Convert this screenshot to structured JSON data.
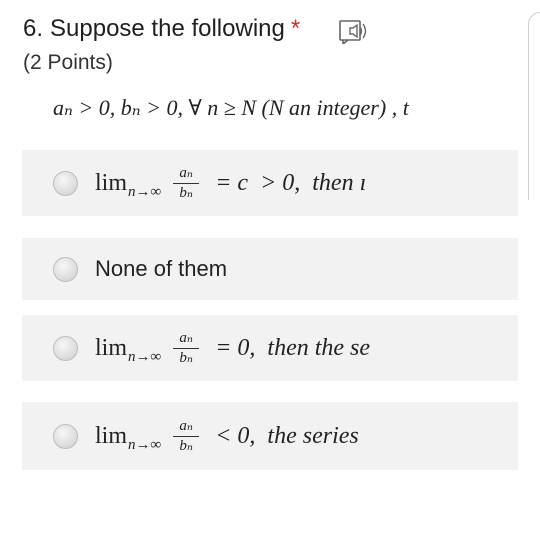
{
  "question": {
    "number": "6.",
    "title": "Suppose the following",
    "required_mark": "*",
    "points": "(2 Points)",
    "prompt": "aₙ > 0, bₙ > 0,  ∀ n ≥ N  (N an integer) , t"
  },
  "options": [
    {
      "lim": "lim",
      "lim_sub": "n→∞",
      "num": "aₙ",
      "den": "bₙ",
      "rest": " = c  > 0,  then ı"
    },
    {
      "plain": "None of them"
    },
    {
      "lim": "lim",
      "lim_sub": "n→∞",
      "num": "aₙ",
      "den": "bₙ",
      "rest": " = 0,  then the se"
    },
    {
      "lim": "lim",
      "lim_sub": "n→∞",
      "num": "aₙ",
      "den": "bₙ",
      "rest": " < 0,  the series"
    }
  ],
  "icons": {
    "speaker": "immersive-reader-speaker-icon",
    "radio": "radio-button"
  },
  "colors": {
    "required": "#d32f2f",
    "option_bg": "#f2f2f2"
  }
}
